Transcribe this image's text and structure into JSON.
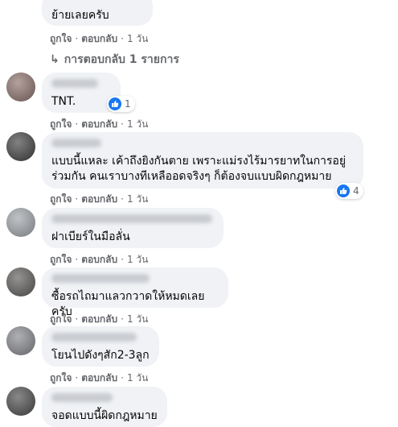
{
  "actions": {
    "like": "ถูกใจ",
    "reply": "ตอบกลับ"
  },
  "replies_link": {
    "arrow": "↳",
    "label": "การตอบกลับ 1 รายการ"
  },
  "comments": [
    {
      "text": "ย้ายเลยครับ",
      "timestamp": "1 วัน"
    },
    {
      "text": "TNT.",
      "timestamp": "1 วัน",
      "reactions": "1"
    },
    {
      "text": "แบบนี้แหละ เค้าถึงยิงกันตาย เพราะแม่รงไร้มารยาทในการอยู่\nร่วมกัน คนเราบางทีเหลืออดจริงๆ ก็ต้องจบแบบผิดกฎหมาย",
      "timestamp": "1 วัน",
      "reactions": "4"
    },
    {
      "text": "ฝาเบียร์ในมือลั่น",
      "timestamp": "1 วัน"
    },
    {
      "text": "ซื้อรถไถมาแลวกวาดให้หมดเลยครับ",
      "timestamp": "1 วัน"
    },
    {
      "text": "โยนไปดังๆสัก2-3ลูก",
      "timestamp": "1 วัน"
    },
    {
      "text": "จอดแบบนี้ผิดกฎหมาย"
    }
  ],
  "colors": {
    "bubble": "#f0f2f5",
    "meta": "#65676b",
    "like": "#1877f2"
  }
}
